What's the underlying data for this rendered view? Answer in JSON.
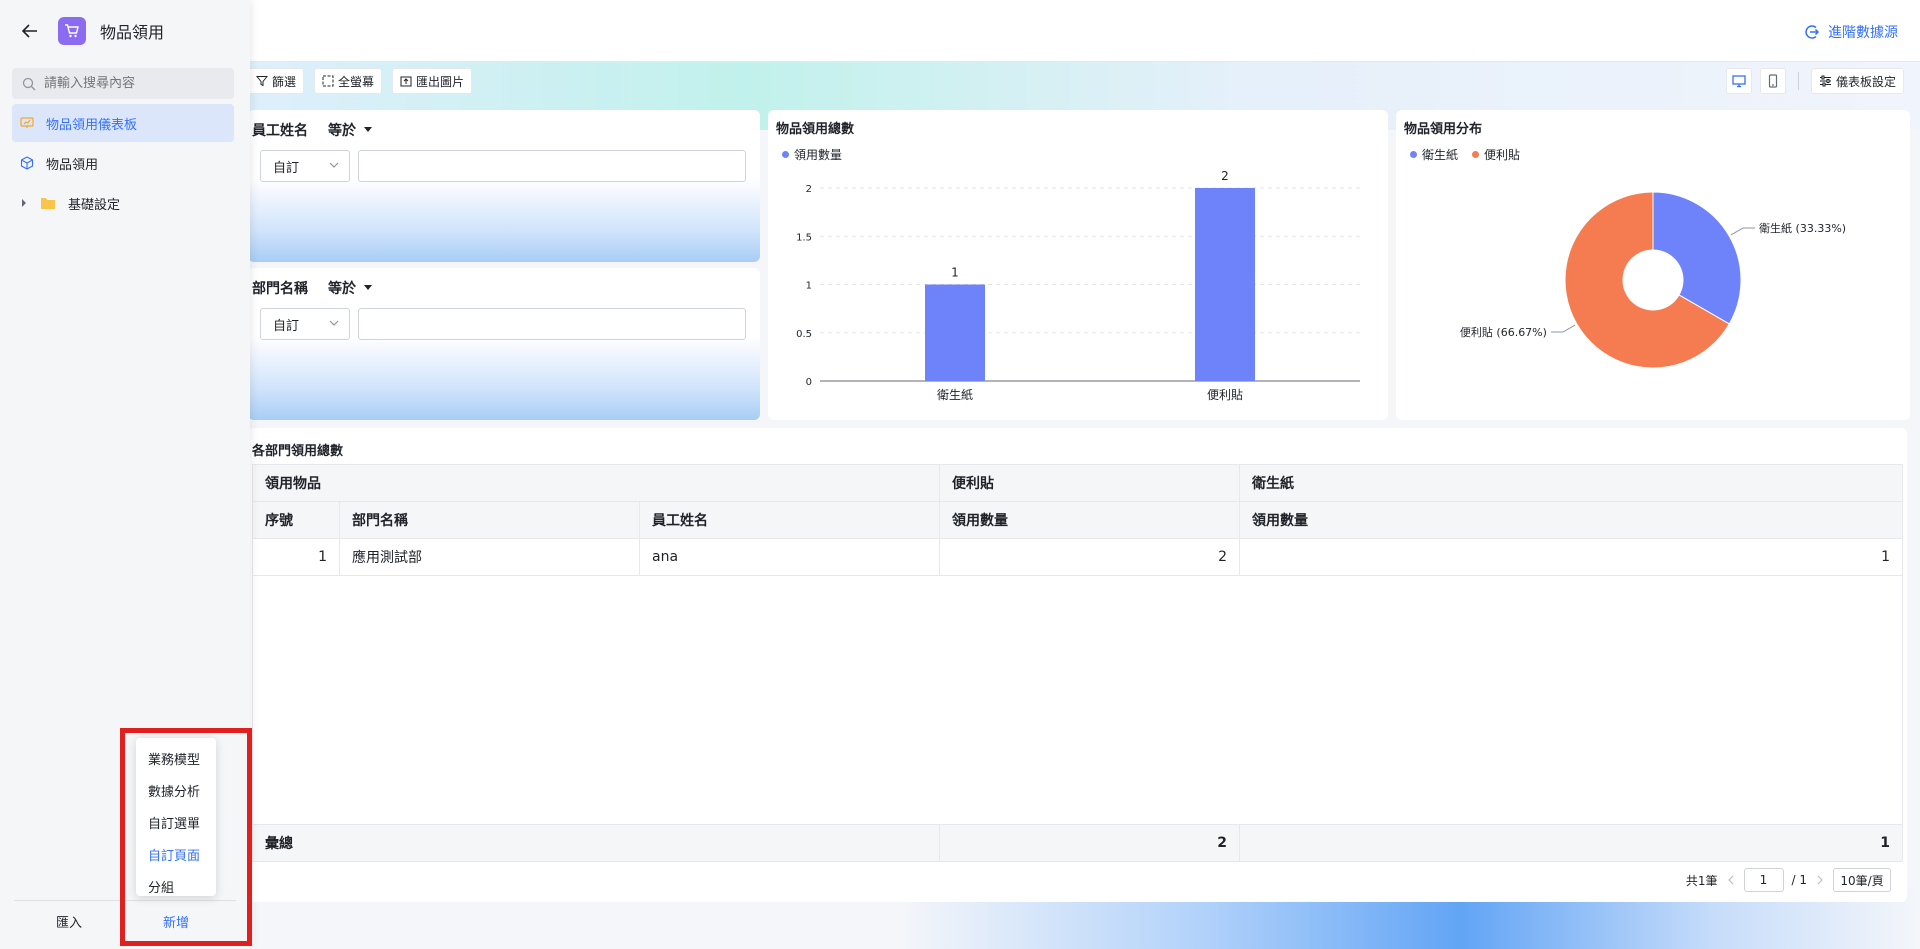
{
  "app": {
    "title": "物品領用"
  },
  "sidebar": {
    "search_placeholder": "請輸入搜尋內容",
    "items": [
      {
        "label": "物品領用儀表板",
        "active": true
      },
      {
        "label": "物品領用"
      },
      {
        "label": "基礎設定"
      }
    ],
    "import_label": "匯入",
    "new_label": "新增",
    "new_menu": [
      "業務模型",
      "數據分析",
      "自訂選單",
      "自訂頁面",
      "分組"
    ]
  },
  "header": {
    "advanced_data_source": "進階數據源"
  },
  "toolbar": {
    "filter": "篩選",
    "fullscreen": "全螢幕",
    "export_image": "匯出圖片",
    "dashboard_settings": "儀表板設定"
  },
  "filters": [
    {
      "label": "員工姓名",
      "operator": "等於",
      "mode": "自訂",
      "value": ""
    },
    {
      "label": "部門名稱",
      "operator": "等於",
      "mode": "自訂",
      "value": ""
    }
  ],
  "bar_card": {
    "title": "物品領用總數",
    "legend": "領用數量",
    "chart_data": {
      "type": "bar",
      "categories": [
        "衛生紙",
        "便利貼"
      ],
      "series": [
        {
          "name": "領用數量",
          "values": [
            1,
            2
          ]
        }
      ],
      "ylim": [
        0,
        2
      ],
      "yticks": [
        "0",
        "0.5",
        "1",
        "1.5",
        "2"
      ],
      "data_labels": [
        "1",
        "2"
      ],
      "grid": true,
      "legend": "top-left",
      "color": "#6e83fa"
    }
  },
  "pie_card": {
    "title": "物品領用分布",
    "legend": [
      "衛生紙",
      "便利貼"
    ],
    "chart_data": {
      "type": "pie",
      "categories": [
        "衛生紙",
        "便利貼"
      ],
      "values": [
        33.33,
        66.67
      ],
      "labels": [
        "衛生紙 (33.33%)",
        "便利貼 (66.67%)"
      ],
      "colors": [
        "#6e83fa",
        "#f47c50"
      ],
      "legend": "top-left",
      "donut": true
    }
  },
  "table": {
    "title": "各部門領用總數",
    "group_header": [
      "領用物品",
      "便利貼",
      "衛生紙"
    ],
    "columns": [
      "序號",
      "部門名稱",
      "員工姓名",
      "領用數量",
      "領用數量"
    ],
    "rows": [
      {
        "no": "1",
        "dept": "應用測試部",
        "name": "ana",
        "sticky": "2",
        "tissue": "1"
      }
    ],
    "total": {
      "label": "彙總",
      "sticky": "2",
      "tissue": "1"
    },
    "pager": {
      "total_text": "共1筆",
      "page": "1",
      "pages": "/ 1",
      "page_size": "10筆/頁"
    }
  }
}
